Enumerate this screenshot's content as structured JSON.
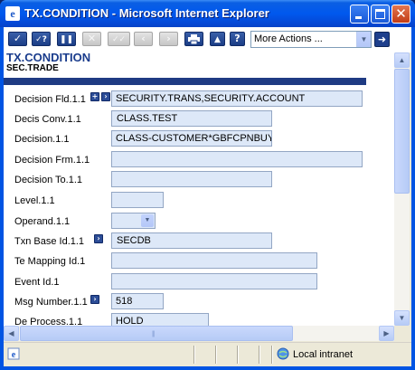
{
  "window": {
    "title": "TX.CONDITION - Microsoft Internet Explorer",
    "icon": "ie-logo-icon"
  },
  "toolbar": {
    "buttons": [
      {
        "name": "commit-button",
        "icon": "checkmark-icon",
        "enabled": true
      },
      {
        "name": "validate-button",
        "icon": "check-question-icon",
        "enabled": true
      },
      {
        "name": "hold-button",
        "icon": "pause-icon",
        "enabled": true
      },
      {
        "name": "delete-button",
        "icon": "x-icon",
        "enabled": false
      },
      {
        "name": "authorise-button",
        "icon": "double-check-icon",
        "enabled": false
      },
      {
        "name": "previous-button",
        "icon": "chevron-left-icon",
        "enabled": false
      },
      {
        "name": "next-button",
        "icon": "chevron-right-icon",
        "enabled": false
      },
      {
        "name": "print-button",
        "icon": "printer-icon",
        "enabled": true
      },
      {
        "name": "scroll-up-button",
        "icon": "chevron-up-icon",
        "enabled": true
      },
      {
        "name": "help-button",
        "icon": "question-icon",
        "enabled": true
      }
    ],
    "more_actions": "More Actions ...",
    "go_icon": "arrow-right-icon"
  },
  "page": {
    "title": "TX.CONDITION",
    "subtitle": "SEC.TRADE",
    "section_color": "#1f3b83"
  },
  "fields": [
    {
      "label": "Decision Fld.1.1",
      "value": "SECURITY.TRANS,SECURITY.ACCOUNT"
    },
    {
      "label": "Decis Conv.1.1",
      "value": "CLASS.TEST"
    },
    {
      "label": "Decision.1.1",
      "value": "CLASS-CUSTOMER*GBFCPNBUY"
    },
    {
      "label": "Decision Frm.1.1",
      "value": ""
    },
    {
      "label": "Decision To.1.1",
      "value": ""
    },
    {
      "label": "Level.1.1",
      "value": ""
    },
    {
      "label": "Operand.1.1",
      "value": ""
    },
    {
      "label": "Txn Base Id.1.1",
      "value": "SECDB"
    },
    {
      "label": "Te Mapping Id.1",
      "value": ""
    },
    {
      "label": "Event Id.1",
      "value": ""
    },
    {
      "label": "Msg Number.1.1",
      "value": "518"
    },
    {
      "label": "De Process.1.1",
      "value": "HOLD"
    }
  ],
  "status": {
    "zone": "Local intranet"
  },
  "colors": {
    "title_bar": "#0058ee",
    "field_bg": "#dde8f8",
    "app_title": "#1a3c8c"
  }
}
